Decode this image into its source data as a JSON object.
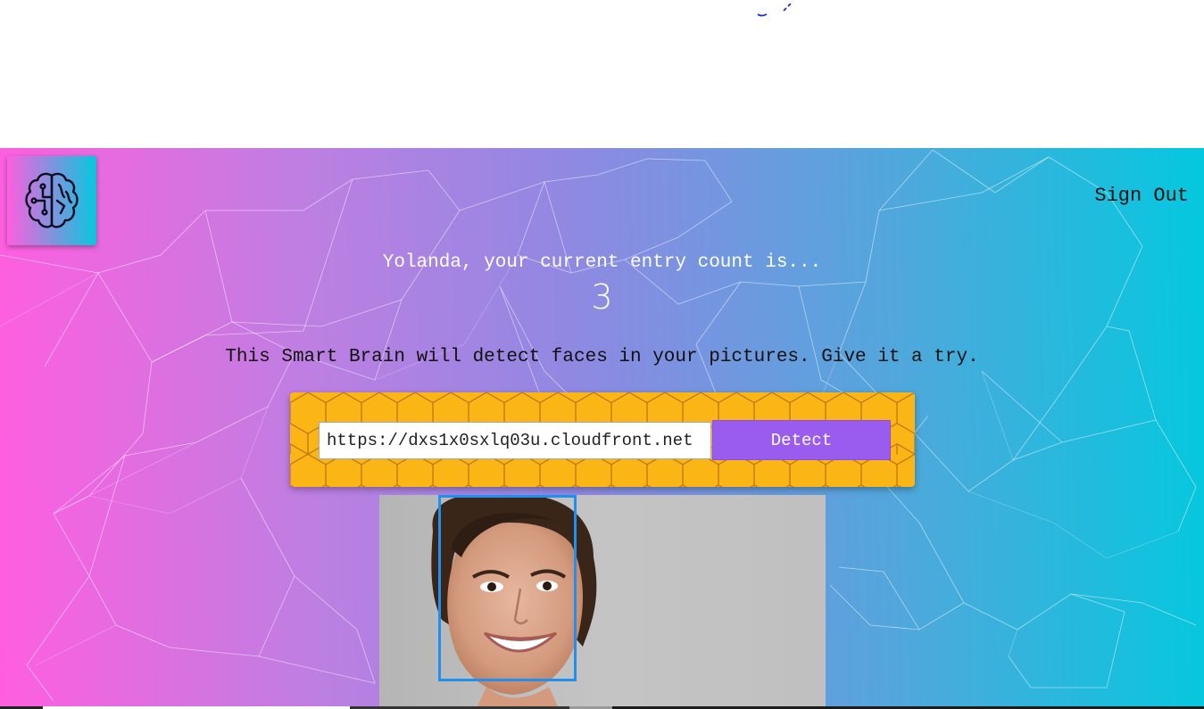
{
  "header": {
    "logo_icon": "brain-circuit-icon",
    "sign_out_label": "Sign Out"
  },
  "rank": {
    "entry_text": "Yolanda, your current entry count is...",
    "entry_count": "3"
  },
  "intro": {
    "text": "This Smart Brain will detect faces in your pictures. Give it a try."
  },
  "form": {
    "url_value": "https://dxs1x0sxlq03u.cloudfront.net",
    "detect_label": "Detect"
  },
  "face_recognition": {
    "image_icon": "smiling-woman-photo",
    "box_color": "#1f8ff0"
  },
  "colors": {
    "gradient_start": "#ff5edf",
    "gradient_end": "#04c8de",
    "panel_yellow": "#fbb616",
    "button_purple": "#9a5cef"
  }
}
